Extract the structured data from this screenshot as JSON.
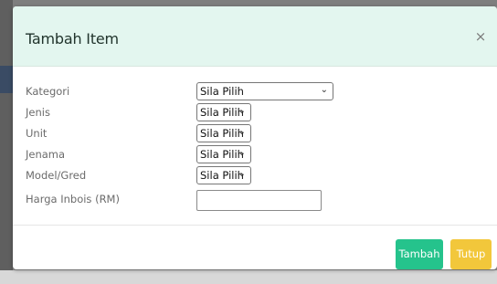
{
  "modal": {
    "title": "Tambah Item",
    "close_glyph": "×"
  },
  "form": {
    "kategori": {
      "label": "Kategori",
      "value": "Sila Pilih"
    },
    "jenis": {
      "label": "Jenis",
      "value": "Sila Pilih"
    },
    "unit": {
      "label": "Unit",
      "value": "Sila Pilih"
    },
    "jenama": {
      "label": "Jenama",
      "value": "Sila Pilih"
    },
    "model": {
      "label": "Model/Gred",
      "value": "Sila Pilih"
    },
    "harga": {
      "label": "Harga Inbois (RM)",
      "value": ""
    },
    "chevron_glyph": "⌄"
  },
  "footer": {
    "tambah_label": "Tambah",
    "tutup_label": "Tutup"
  },
  "colors": {
    "header_bg": "#e3f6ef",
    "tambah_button": "#25c38c",
    "tutup_button": "#f2c73b"
  },
  "icons": {
    "close": "close-icon",
    "select": "chevron-down-icon"
  }
}
